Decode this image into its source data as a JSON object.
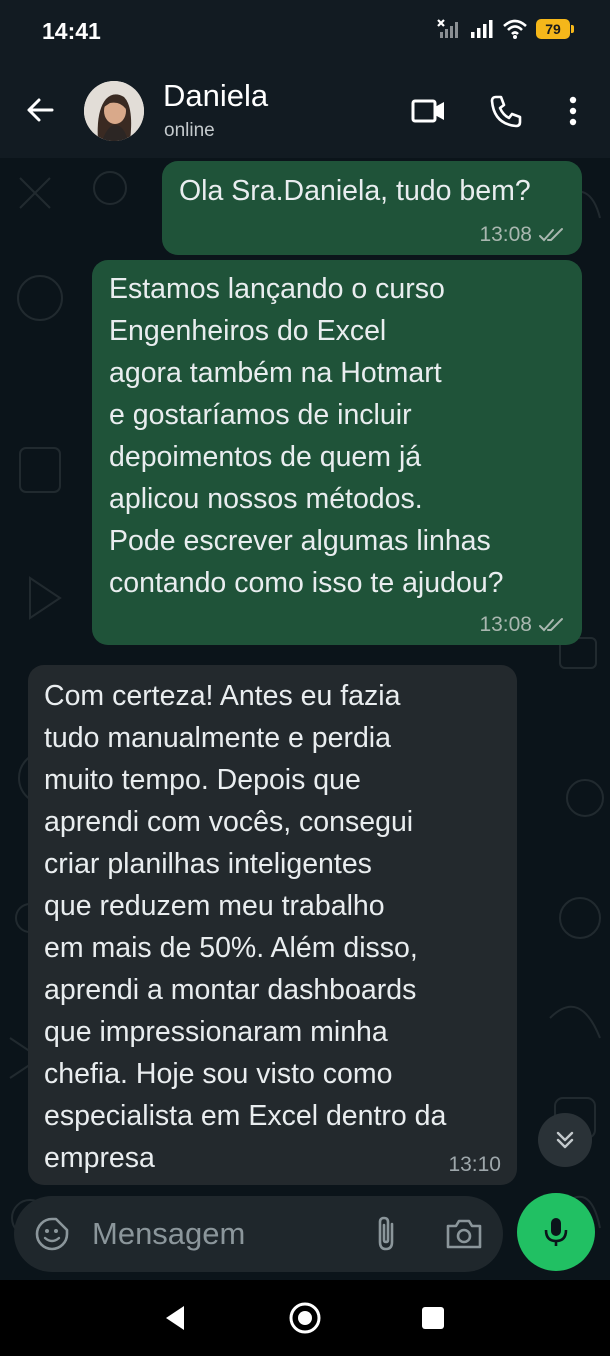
{
  "status_bar": {
    "time": "14:41",
    "battery": "79",
    "icons": [
      "signal-x-icon",
      "signal-icon",
      "wifi-icon",
      "battery-icon"
    ]
  },
  "header": {
    "contact_name": "Daniela",
    "contact_status": "online",
    "icons": [
      "back-arrow-icon",
      "video-call-icon",
      "voice-call-icon",
      "more-vert-icon"
    ]
  },
  "messages": [
    {
      "direction": "outgoing",
      "text": "Ola Sra.Daniela, tudo bem?",
      "time": "13:08",
      "status": "read"
    },
    {
      "direction": "outgoing",
      "text": "Estamos lançando o curso\nEngenheiros do Excel\nagora também na Hotmart\ne gostaríamos de incluir\ndepoimentos de quem já\naplicou nossos métodos.\nPode escrever algumas linhas\ncontando como isso te ajudou?",
      "time": "13:08",
      "status": "read"
    },
    {
      "direction": "incoming",
      "text": "Com certeza! Antes eu fazia\ntudo manualmente e perdia\nmuito tempo. Depois que\naprendi com vocês, consegui\ncriar planilhas inteligentes\nque reduzem meu trabalho\nem mais de 50%. Além disso,\naprendi a montar dashboards\nque impressionaram minha\nchefia. Hoje sou visto como\nespecialista em Excel dentro da\nempresa",
      "time": "13:10"
    }
  ],
  "input": {
    "placeholder": "Mensagem",
    "value": ""
  },
  "colors": {
    "background": "#0b141a",
    "bar": "#121b22",
    "outgoing_bubble": "#1f5339",
    "incoming_bubble": "#23292d",
    "accent": "#21c063"
  }
}
